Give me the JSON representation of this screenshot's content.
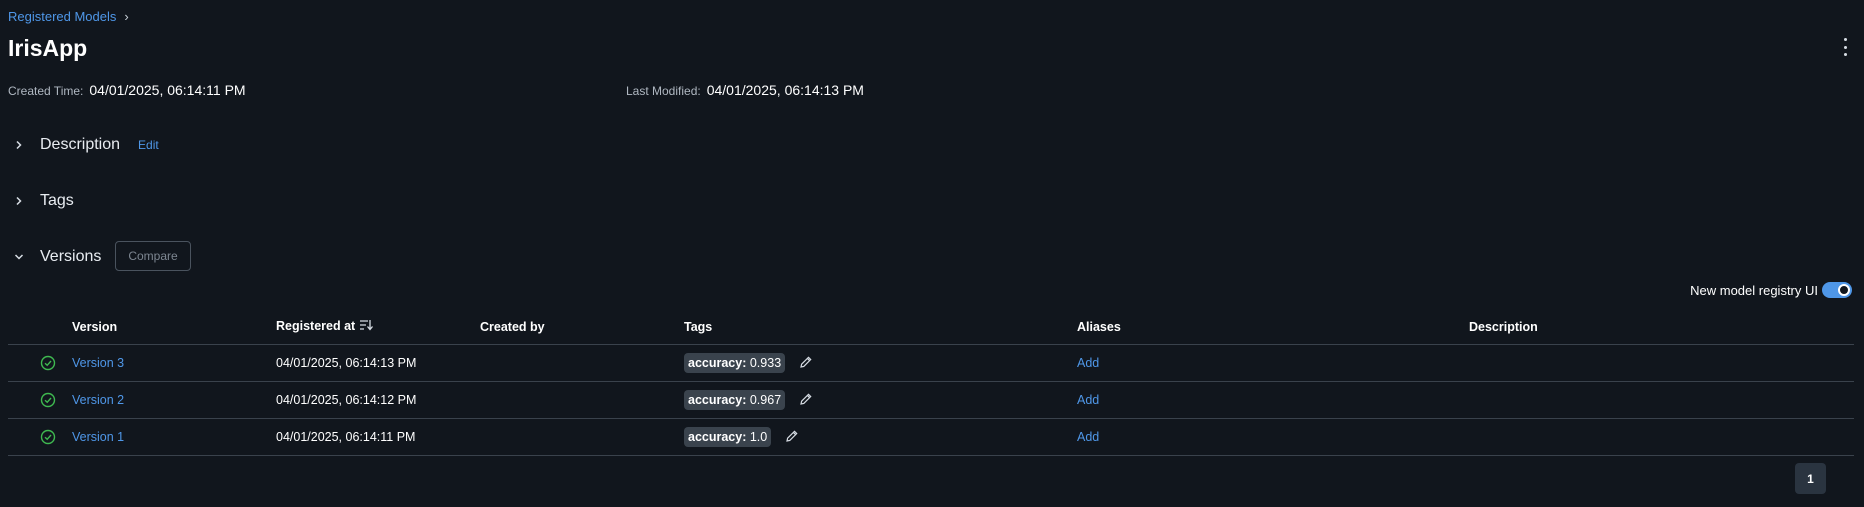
{
  "breadcrumb": {
    "parent": "Registered Models",
    "separator": "›"
  },
  "page_title": "IrisApp",
  "meta": {
    "created_label": "Created Time:",
    "created_value": "04/01/2025, 06:14:11 PM",
    "modified_label": "Last Modified:",
    "modified_value": "04/01/2025, 06:14:13 PM"
  },
  "sections": {
    "description": {
      "title": "Description",
      "edit_label": "Edit",
      "expanded": false
    },
    "tags": {
      "title": "Tags",
      "expanded": false
    },
    "versions": {
      "title": "Versions",
      "compare_label": "Compare",
      "expanded": true
    }
  },
  "toggle": {
    "label": "New model registry UI",
    "on": true
  },
  "table": {
    "headers": [
      "Version",
      "Registered at",
      "Created by",
      "Tags",
      "Aliases",
      "Description"
    ],
    "rows": [
      {
        "version": "Version 3",
        "registered_at": "04/01/2025, 06:14:13 PM",
        "created_by": "",
        "tag_key": "accuracy:",
        "tag_value": "0.933",
        "alias": "Add",
        "description": ""
      },
      {
        "version": "Version 2",
        "registered_at": "04/01/2025, 06:14:12 PM",
        "created_by": "",
        "tag_key": "accuracy:",
        "tag_value": "0.967",
        "alias": "Add",
        "description": ""
      },
      {
        "version": "Version 1",
        "registered_at": "04/01/2025, 06:14:11 PM",
        "created_by": "",
        "tag_key": "accuracy:",
        "tag_value": "1.0",
        "alias": "Add",
        "description": ""
      }
    ]
  },
  "pagination": {
    "current_page": "1"
  },
  "colors": {
    "accent": "#4f97e8",
    "success": "#3fb950",
    "background": "#11161d"
  }
}
